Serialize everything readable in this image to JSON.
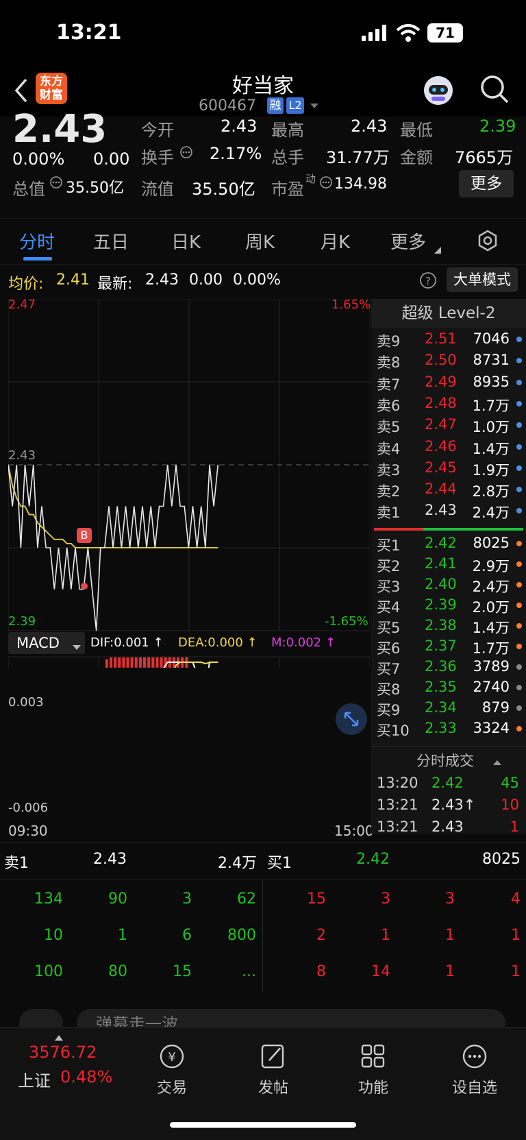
{
  "status": {
    "time": "13:21",
    "battery": "71"
  },
  "nav": {
    "title": "好当家",
    "code": "600467",
    "tag_rong": "融",
    "tag_l2": "L2",
    "logo_line1": "东方",
    "logo_line2": "财富"
  },
  "quote": {
    "price": "2.43",
    "change_pct": "0.00%",
    "change": "0.00",
    "open_label": "今开",
    "open": "2.43",
    "high_label": "最高",
    "high": "2.43",
    "low_label": "最低",
    "low": "2.39",
    "turnover_label": "换手",
    "turnover": "2.17%",
    "vol_label": "总手",
    "vol": "31.77万",
    "amount_label": "金额",
    "amount": "7665万",
    "mcap_label": "总值",
    "mcap": "35.50亿",
    "float_label": "流值",
    "float": "35.50亿",
    "pe_label": "市盈",
    "pe_sup": "动",
    "pe": "134.98",
    "more_button": "更多"
  },
  "tabs": [
    "分时",
    "五日",
    "日K",
    "周K",
    "月K",
    "更多"
  ],
  "info": {
    "avg_label": "均价:",
    "avg": "2.41",
    "last_label": "最新:",
    "last": "2.43",
    "chg": "0.00",
    "chg_pct": "0.00%",
    "mode_button": "大单模式"
  },
  "chart_data": {
    "type": "line",
    "price_axis": {
      "top": "2.47",
      "mid": "2.43",
      "bottom": "2.39",
      "top_pct": "1.65%",
      "bottom_pct": "-1.65%"
    },
    "time_axis": {
      "start": "09:30",
      "end": "15:00"
    },
    "marker": "B",
    "macd": {
      "label": "MACD",
      "dif": "DIF:0.001 ↑",
      "dea": "DEA:0.000 ↑",
      "m": "M:0.002 ↑",
      "top": "0.003",
      "bottom": "-0.006"
    },
    "price_series": [
      2.43,
      2.42,
      2.43,
      2.41,
      2.43,
      2.42,
      2.43,
      2.41,
      2.42,
      2.41,
      2.41,
      2.4,
      2.41,
      2.4,
      2.41,
      2.4,
      2.41,
      2.4,
      2.4,
      2.41,
      2.4,
      2.39,
      2.41,
      2.41,
      2.42,
      2.41,
      2.42,
      2.41,
      2.42,
      2.41,
      2.42,
      2.41,
      2.42,
      2.41,
      2.42,
      2.41,
      2.42,
      2.42,
      2.43,
      2.42,
      2.43,
      2.42,
      2.42,
      2.41,
      2.42,
      2.41,
      2.42,
      2.41,
      2.43,
      2.42,
      2.43
    ],
    "avg_series": [
      2.43,
      2.425,
      2.422,
      2.42,
      2.42,
      2.418,
      2.418,
      2.416,
      2.415,
      2.414,
      2.413,
      2.412,
      2.412,
      2.412,
      2.411,
      2.411,
      2.41,
      2.41,
      2.41,
      2.41,
      2.41,
      2.41,
      2.41,
      2.41,
      2.41,
      2.41,
      2.41,
      2.41,
      2.41,
      2.41,
      2.41,
      2.41,
      2.41,
      2.41,
      2.41,
      2.41,
      2.41,
      2.41,
      2.41,
      2.41,
      2.41,
      2.41,
      2.41,
      2.41,
      2.41,
      2.41,
      2.41,
      2.41,
      2.41,
      2.41,
      2.41
    ]
  },
  "orderbook": {
    "title": "超级 Level-2",
    "sells": [
      {
        "label": "卖9",
        "price": "2.51",
        "vol": "7046"
      },
      {
        "label": "卖8",
        "price": "2.50",
        "vol": "8731"
      },
      {
        "label": "卖7",
        "price": "2.49",
        "vol": "8935"
      },
      {
        "label": "卖6",
        "price": "2.48",
        "vol": "1.7万"
      },
      {
        "label": "卖5",
        "price": "2.47",
        "vol": "1.0万"
      },
      {
        "label": "卖4",
        "price": "2.46",
        "vol": "1.4万"
      },
      {
        "label": "卖3",
        "price": "2.45",
        "vol": "1.9万"
      },
      {
        "label": "卖2",
        "price": "2.44",
        "vol": "2.8万"
      },
      {
        "label": "卖1",
        "price": "2.43",
        "vol": "2.4万"
      }
    ],
    "buys": [
      {
        "label": "买1",
        "price": "2.42",
        "vol": "8025"
      },
      {
        "label": "买2",
        "price": "2.41",
        "vol": "2.9万"
      },
      {
        "label": "买3",
        "price": "2.40",
        "vol": "2.4万"
      },
      {
        "label": "买4",
        "price": "2.39",
        "vol": "2.0万"
      },
      {
        "label": "买5",
        "price": "2.38",
        "vol": "1.4万"
      },
      {
        "label": "买6",
        "price": "2.37",
        "vol": "1.7万"
      },
      {
        "label": "买7",
        "price": "2.36",
        "vol": "3789"
      },
      {
        "label": "买8",
        "price": "2.35",
        "vol": "2740"
      },
      {
        "label": "买9",
        "price": "2.34",
        "vol": "879"
      },
      {
        "label": "买10",
        "price": "2.33",
        "vol": "3324"
      }
    ],
    "trades_title": "分时成交",
    "trades": [
      {
        "time": "13:20",
        "price": "2.42",
        "vol": "45"
      },
      {
        "time": "13:21",
        "price": "2.43↑",
        "vol": "10"
      },
      {
        "time": "13:21",
        "price": "2.43",
        "vol": "1"
      }
    ]
  },
  "queue": {
    "sell_label": "卖1",
    "sell_price": "2.43",
    "sell_vol": "2.4万",
    "buy_label": "买1",
    "buy_price": "2.42",
    "buy_vol": "8025",
    "sell_rows": [
      [
        "134",
        "90",
        "3",
        "62"
      ],
      [
        "10",
        "1",
        "6",
        "800"
      ],
      [
        "100",
        "80",
        "15",
        "..."
      ]
    ],
    "buy_rows": [
      [
        "15",
        "3",
        "3",
        "4"
      ],
      [
        "2",
        "1",
        "1",
        "1"
      ],
      [
        "8",
        "14",
        "1",
        "1"
      ]
    ]
  },
  "comment_placeholder": "弹幕走一波",
  "tabbar": {
    "index_value": "3576.72",
    "index_name": "上证",
    "index_pct": "0.48%",
    "items": [
      "交易",
      "发帖",
      "功能",
      "设自选"
    ]
  }
}
